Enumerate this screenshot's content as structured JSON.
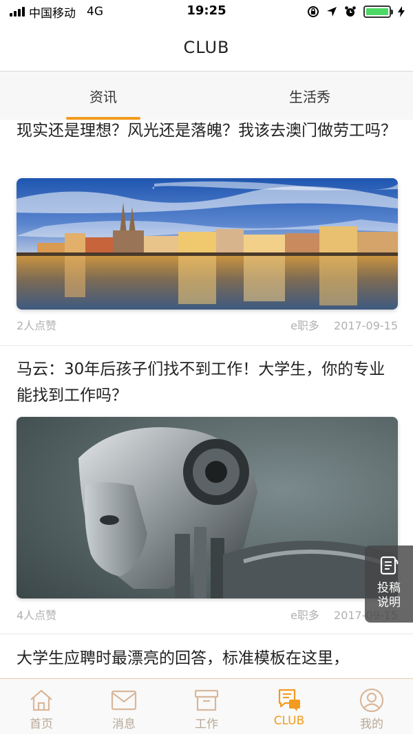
{
  "status_bar": {
    "carrier": "中国移动",
    "network": "4G",
    "time": "19:25"
  },
  "nav": {
    "title": "CLUB"
  },
  "tabs": [
    {
      "label": "资讯",
      "active": true
    },
    {
      "label": "生活秀",
      "active": false
    }
  ],
  "articles": [
    {
      "title": "现实还是理想？风光还是落魄？我该去澳门做劳工吗？",
      "image": "city-waterfront-photo",
      "likes": "2人点赞",
      "source": "e职多",
      "date": "2017-09-15"
    },
    {
      "title": "马云：30年后孩子们找不到工作！大学生，你的专业能找到工作吗？",
      "image": "robot-head-photo",
      "likes": "4人点赞",
      "source": "e职多",
      "date": "2017-09-15"
    },
    {
      "title": "大学生应聘时最漂亮的回答，标准模板在这里，"
    }
  ],
  "floating_button": {
    "label": "投稿说明",
    "icon": "document-icon"
  },
  "tab_bar": [
    {
      "label": "首页",
      "icon": "home-icon",
      "active": false
    },
    {
      "label": "消息",
      "icon": "mail-icon",
      "active": false
    },
    {
      "label": "工作",
      "icon": "briefcase-icon",
      "active": false
    },
    {
      "label": "CLUB",
      "icon": "club-chat-icon",
      "active": true
    },
    {
      "label": "我的",
      "icon": "profile-icon",
      "active": false
    }
  ],
  "colors": {
    "accent": "#f29b1e",
    "tab_inactive": "#b8a897",
    "meta_text": "#b0b0b0"
  }
}
